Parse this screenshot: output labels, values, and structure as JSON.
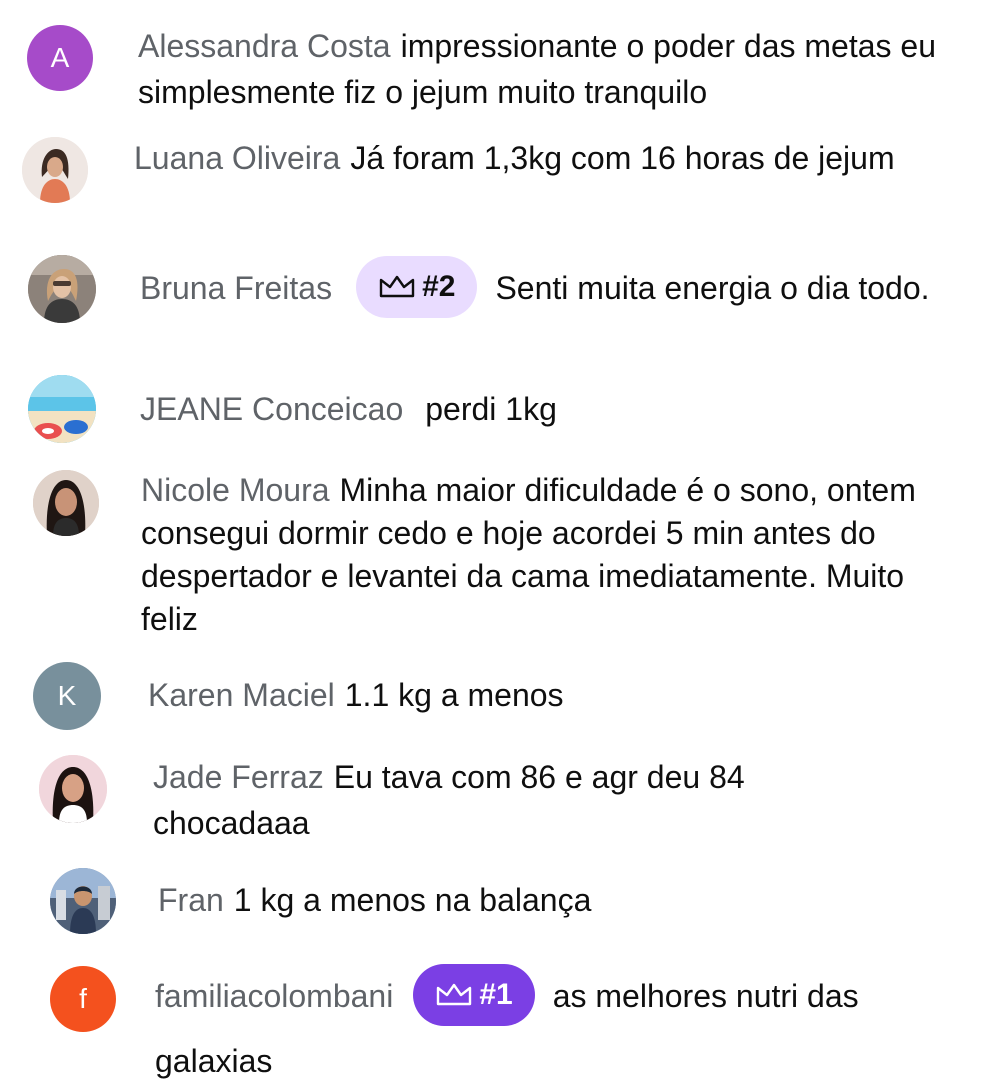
{
  "messages": [
    {
      "author": "Alessandra Costa",
      "text": "impressionante o poder das metas eu simplesmente fiz o jejum muito tranquilo",
      "avatar_letter": "A",
      "avatar_color": "#a64bc9"
    },
    {
      "author": "Luana Oliveira",
      "text": "Já foram 1,3kg com 16 horas de jejum"
    },
    {
      "author": "Bruna Freitas",
      "badge": "#2",
      "text": "Senti muita energia o dia todo."
    },
    {
      "author": "JEANE Conceicao",
      "text": "perdi 1kg"
    },
    {
      "author": "Nicole Moura",
      "text": "Minha maior dificuldade é o sono, ontem consegui dormir cedo e hoje acordei 5 min antes do despertador e levantei da cama imediatamente. Muito feliz"
    },
    {
      "author": "Karen Maciel",
      "text": "1.1 kg a menos",
      "avatar_letter": "K",
      "avatar_color": "#78909c"
    },
    {
      "author": "Jade Ferraz",
      "text": "Eu tava com 86 e agr deu 84 chocadaaa"
    },
    {
      "author": "Fran",
      "text": "1 kg a menos na balança"
    },
    {
      "author": "familiacolombani",
      "badge": "#1",
      "text": "as melhores nutri das galaxias",
      "avatar_letter": "f",
      "avatar_color": "#f4511e"
    }
  ],
  "colors": {
    "author_text": "#5f6368",
    "message_text": "#0f0f0f",
    "badge_light": "#e9dcff",
    "badge_dark": "#7b3fe4"
  },
  "icons": {
    "badge_icon": "crown-icon"
  }
}
